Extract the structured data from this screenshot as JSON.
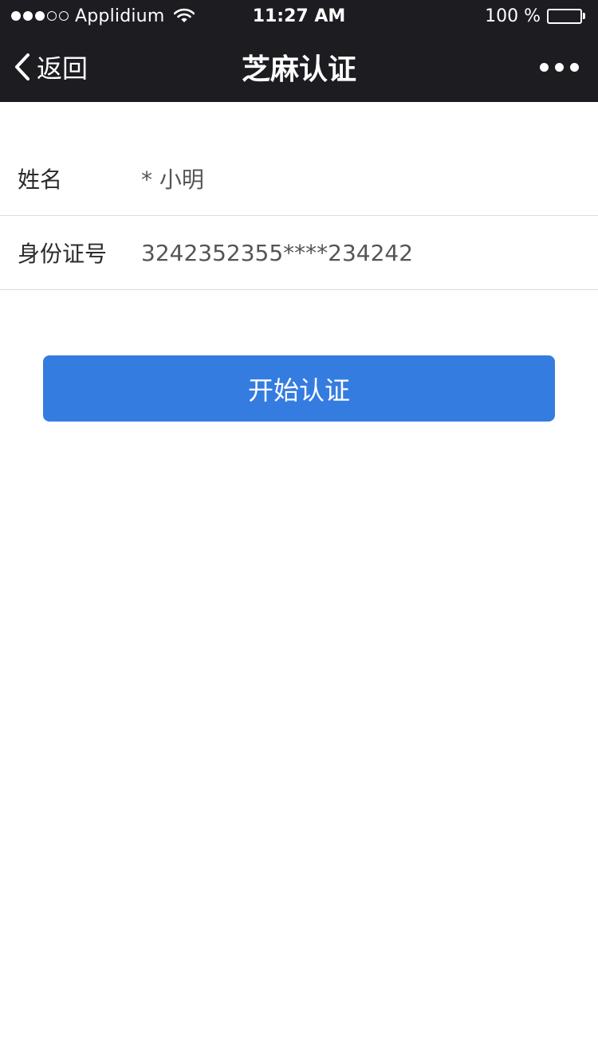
{
  "status_bar": {
    "carrier": "Applidium",
    "time": "11:27 AM",
    "battery_text": "100 %",
    "signal_bars_filled": 3,
    "signal_bars_total": 5,
    "wifi_icon": "wifi-icon",
    "battery_level": 1.0
  },
  "nav": {
    "back_label": "返回",
    "title": "芝麻认证",
    "back_icon": "chevron-left-icon",
    "more_icon": "more-dots-icon"
  },
  "form": {
    "name_label": "姓名",
    "name_value": "* 小明",
    "id_label": "身份证号",
    "id_value": "3242352355****234242"
  },
  "actions": {
    "start_label": "开始认证"
  },
  "colors": {
    "header_bg": "#1d1d21",
    "button_bg": "#357ce1",
    "divider": "#dcdcdc"
  }
}
